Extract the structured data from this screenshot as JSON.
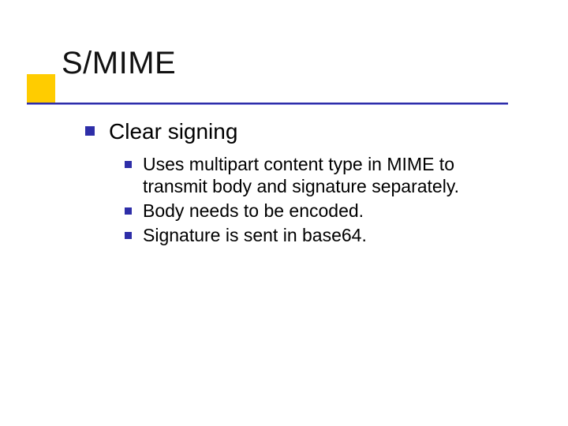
{
  "title": "S/MIME",
  "body": {
    "item": {
      "text": "Clear signing",
      "sub": [
        "Uses multipart content type in MIME to transmit body and signature separately.",
        "Body needs to be encoded.",
        "Signature is sent in base64."
      ]
    }
  },
  "colors": {
    "accent_square": "#ffcc00",
    "rule": "#2e2ea8",
    "bullet": "#2e2ea8"
  }
}
